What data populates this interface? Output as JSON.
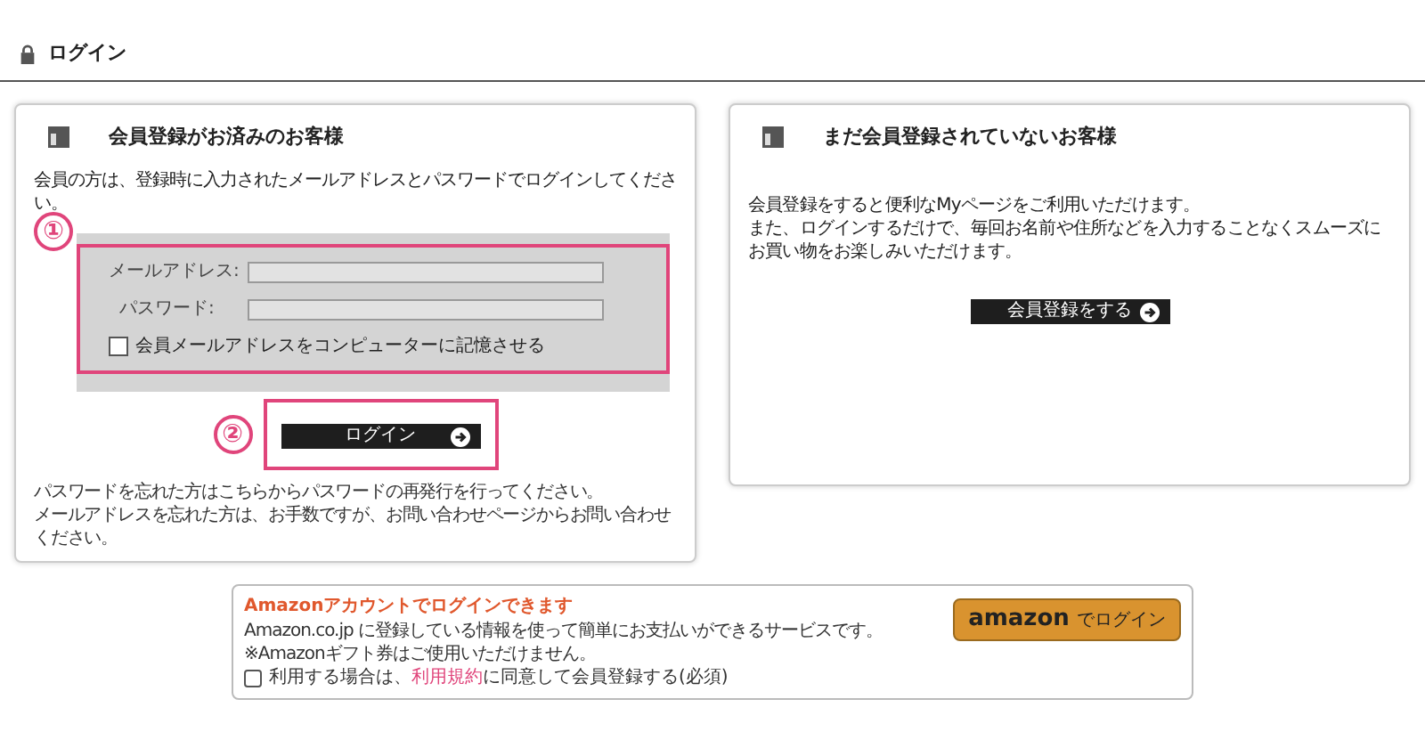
{
  "page_title": "ログイン",
  "member_card": {
    "title": "会員登録がお済みのお客様",
    "intro": "会員の方は、登録時に入力されたメールアドレスとパスワードでログインしてください。",
    "fields": [
      {
        "label": "メールアドレス:"
      },
      {
        "label": "パスワード:"
      }
    ],
    "remember": {
      "label": "会員メールアドレスをコンピューターに記憶させる",
      "checked": false
    },
    "login_button": "ログイン",
    "notes": [
      "パスワードを忘れた方はこちらからパスワードの再発行を行ってください。",
      "メールアドレスを忘れた方は、お手数ですが、お問い合わせページからお問い合わせください。"
    ]
  },
  "guest_card": {
    "title": "まだ会員登録されていないお客様",
    "lines": [
      "会員登録をすると便利なMyページをご利用いただけます。",
      "また、ログインするだけで、毎回お名前や住所などを入力することなくスムーズにお買い物をお楽しみいただけます。"
    ],
    "register_button": "会員登録をする"
  },
  "amazon": {
    "title": "Amazonアカウントでログインできます",
    "lines": [
      "Amazon.co.jp に登録している情報を使って簡単にお支払いができるサービスです。",
      "※Amazonギフト券はご使用いただけません。"
    ],
    "agree": {
      "before": "利用する場合は、",
      "link": "利用規約",
      "after": "に同意して会員登録する(必須)",
      "checked": false
    },
    "button_logo": "amazon",
    "button_text": "でログイン"
  },
  "annotations": [
    "①",
    "②"
  ]
}
